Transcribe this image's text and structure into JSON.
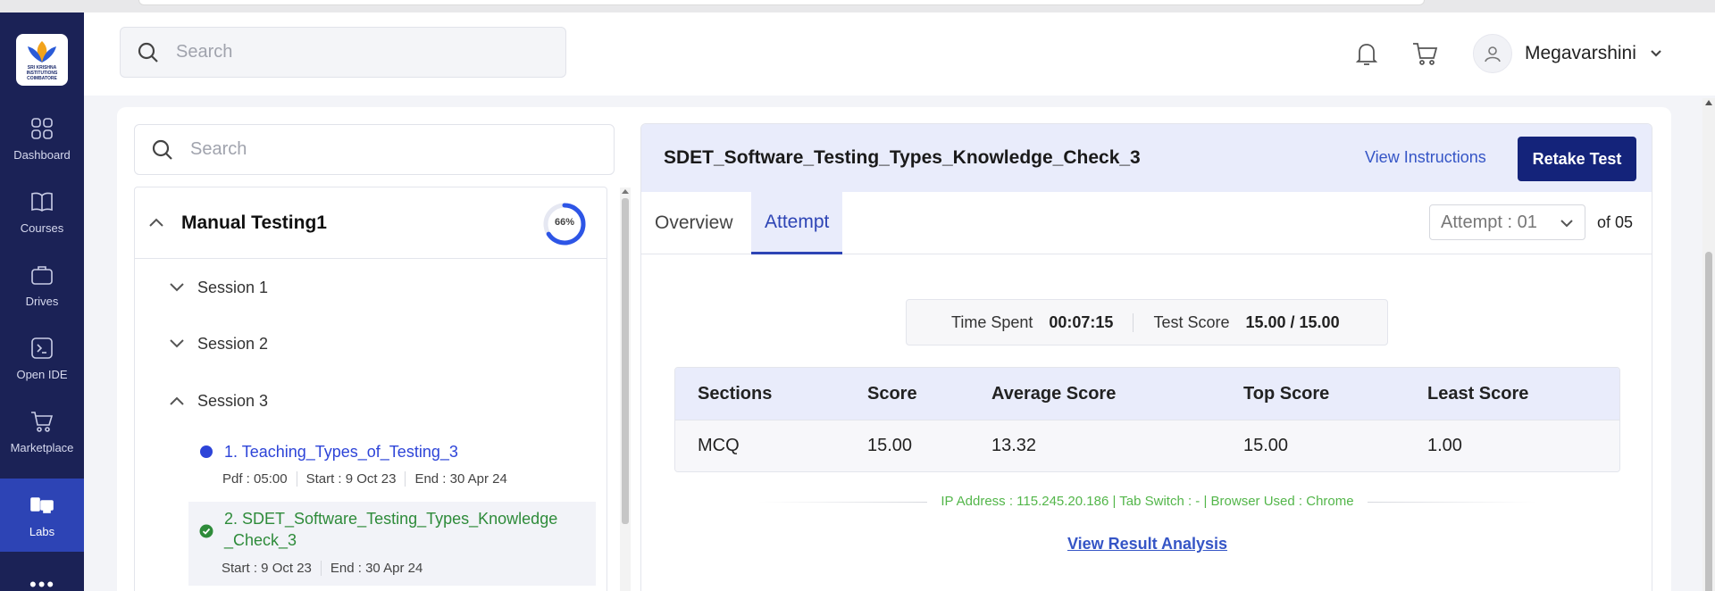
{
  "header": {
    "search_placeholder": "Search",
    "user_name": "Megavarshini"
  },
  "logo": {
    "text_line1": "SRI KRISHNA",
    "text_line2": "INSTITUTIONS",
    "text_line3": "COIMBATORE"
  },
  "sidebar": {
    "items": [
      {
        "label": "Dashboard",
        "icon": "grid-icon"
      },
      {
        "label": "Courses",
        "icon": "book-icon"
      },
      {
        "label": "Drives",
        "icon": "briefcase-icon"
      },
      {
        "label": "Open IDE",
        "icon": "terminal-icon"
      },
      {
        "label": "Marketplace",
        "icon": "cart-icon"
      },
      {
        "label": "Labs",
        "icon": "labs-icon",
        "active": true
      }
    ]
  },
  "left_panel": {
    "search_placeholder": "Search",
    "module_title": "Manual Testing1",
    "progress_percent": 66,
    "progress_label": "66%",
    "sessions": [
      {
        "label": "Session 1",
        "expanded": false
      },
      {
        "label": "Session 2",
        "expanded": false
      },
      {
        "label": "Session 3",
        "expanded": true
      }
    ],
    "lessons": [
      {
        "title": "1. Teaching_Types_of_Testing_3",
        "meta": [
          "Pdf : 05:00",
          "Start : 9 Oct 23",
          "End : 30 Apr 24"
        ],
        "status": "in-progress",
        "color": "#2d44d8"
      },
      {
        "title_line1": "2. SDET_Software_Testing_Types_Knowledge",
        "title_line2": "_Check_3",
        "meta": [
          "Start : 9 Oct 23",
          "End : 30 Apr 24"
        ],
        "status": "completed",
        "color": "#2e8b3a"
      }
    ]
  },
  "test": {
    "title": "SDET_Software_Testing_Types_Knowledge_Check_3",
    "view_instructions": "View Instructions",
    "retake_label": "Retake Test",
    "tabs": [
      "Overview",
      "Attempt"
    ],
    "active_tab": "Attempt",
    "attempt_select": "Attempt : 01",
    "attempt_total": "of 05",
    "time_spent_label": "Time Spent",
    "time_spent_value": "00:07:15",
    "test_score_label": "Test Score",
    "test_score_value": "15.00 / 15.00",
    "table": {
      "headers": [
        "Sections",
        "Score",
        "Average Score",
        "Top Score",
        "Least Score"
      ],
      "rows": [
        [
          "MCQ",
          "15.00",
          "13.32",
          "15.00",
          "1.00"
        ]
      ]
    },
    "ip_info": "IP Address : 115.245.20.186 | Tab Switch : - | Browser Used : Chrome",
    "result_link": "View Result Analysis"
  },
  "colors": {
    "sidebar_bg": "#1b2256",
    "accent": "#2d44b5",
    "retake_bg": "#14237a",
    "success": "#2e8b3a",
    "ip_text": "#53b64a"
  }
}
